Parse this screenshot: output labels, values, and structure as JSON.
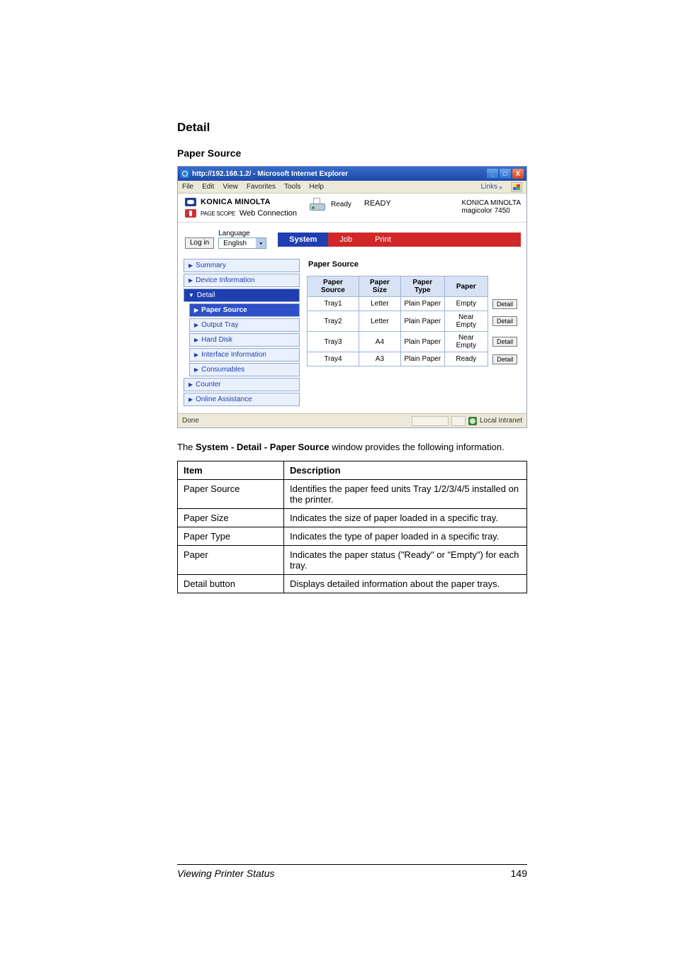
{
  "headings": {
    "detail": "Detail",
    "paper_source": "Paper Source"
  },
  "shot": {
    "titlebar": {
      "title": "http://192.168.1.2/ - Microsoft Internet Explorer",
      "min": "_",
      "max": "□",
      "close": "X"
    },
    "menubar": {
      "file": "File",
      "edit": "Edit",
      "view": "View",
      "favorites": "Favorites",
      "tools": "Tools",
      "help": "Help",
      "links": "Links",
      "chev": "»"
    },
    "header": {
      "brand": "KONICA MINOLTA",
      "ps_label": "PAGE SCOPE",
      "webconn": "Web Connection",
      "status_label": "Ready",
      "ready": "READY",
      "right_brand": "KONICA MINOLTA",
      "model": "magicolor 7450"
    },
    "login": {
      "button": "Log in",
      "lang_label": "Language",
      "lang_value": "English",
      "chev": "▾"
    },
    "tabs": {
      "system": "System",
      "job": "Job",
      "print": "Print"
    },
    "sidebar": {
      "summary": "Summary",
      "device_info": "Device Information",
      "detail": "Detail",
      "paper_source": "Paper Source",
      "output_tray": "Output Tray",
      "hard_disk": "Hard Disk",
      "interface_info": "Interface Information",
      "consumables": "Consumables",
      "counter": "Counter",
      "online_assistance": "Online Assistance",
      "tri_right": "▶",
      "tri_down": "▼"
    },
    "panel": {
      "title": "Paper Source",
      "th_source": "Paper Source",
      "th_size": "Paper Size",
      "th_type": "Paper Type",
      "th_paper": "Paper",
      "rows": {
        "r1": {
          "source": "Tray1",
          "size": "Letter",
          "type": "Plain Paper",
          "paper": "Empty",
          "btn": "Detail"
        },
        "r2": {
          "source": "Tray2",
          "size": "Letter",
          "type": "Plain Paper",
          "paper": "Near Empty",
          "btn": "Detail"
        },
        "r3": {
          "source": "Tray3",
          "size": "A4",
          "type": "Plain Paper",
          "paper": "Near Empty",
          "btn": "Detail"
        },
        "r4": {
          "source": "Tray4",
          "size": "A3",
          "type": "Plain Paper",
          "paper": "Ready",
          "btn": "Detail"
        }
      }
    },
    "statusbar": {
      "done": "Done",
      "intranet": "Local intranet"
    }
  },
  "paragraph": {
    "pre": "The ",
    "bold": "System - Detail - Paper Source",
    "post": " window provides the following information."
  },
  "desc": {
    "th_item": "Item",
    "th_desc": "Description",
    "r1": {
      "item": "Paper Source",
      "desc": "Identifies the paper feed units Tray 1/2/3/4/5 installed on the printer."
    },
    "r2": {
      "item": "Paper Size",
      "desc": "Indicates the size of paper loaded in a specific tray."
    },
    "r3": {
      "item": "Paper Type",
      "desc": "Indicates the type of paper loaded in a specific tray."
    },
    "r4": {
      "item": "Paper",
      "desc": "Indicates the paper status (\"Ready\" or \"Empty\") for each tray."
    },
    "r5": {
      "item": "Detail button",
      "desc": "Displays detailed information about the paper trays."
    }
  },
  "footer": {
    "title": "Viewing Printer Status",
    "page": "149"
  }
}
